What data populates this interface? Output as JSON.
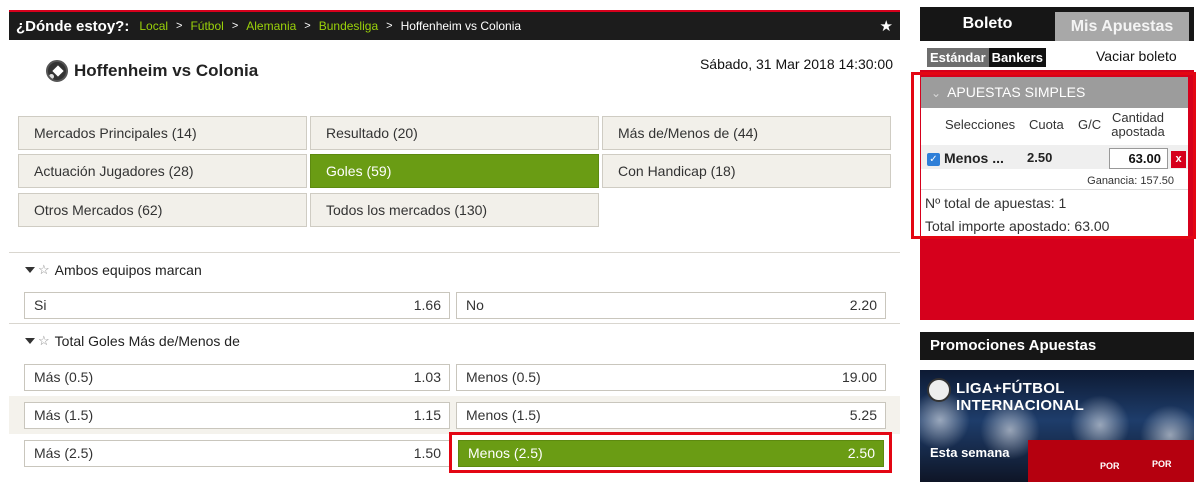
{
  "breadcrumb": {
    "title": "¿Dónde estoy?:",
    "links": [
      "Local",
      "Fútbol",
      "Alemania",
      "Bundesliga"
    ],
    "current": "Hoffenheim vs Colonia",
    "separator": ">"
  },
  "match": {
    "title": "Hoffenheim vs Colonia",
    "date": "Sábado, 31 Mar 2018 14:30:00",
    "icon": "football-icon"
  },
  "categories": [
    {
      "label": "Mercados Principales (14)"
    },
    {
      "label": "Resultado (20)"
    },
    {
      "label": "Más de/Menos de (44)"
    },
    {
      "label": "Actuación Jugadores (28)"
    },
    {
      "label": "Goles (59)",
      "active": true
    },
    {
      "label": "Con Handicap (18)"
    },
    {
      "label": "Otros Mercados (62)"
    },
    {
      "label": "Todos los mercados (130)"
    }
  ],
  "markets": [
    {
      "title": "Ambos equipos marcan",
      "rows": [
        [
          {
            "label": "Si",
            "odds": "1.66"
          },
          {
            "label": "No",
            "odds": "2.20"
          }
        ]
      ]
    },
    {
      "title": "Total Goles Más de/Menos de",
      "rows": [
        [
          {
            "label": "Más (0.5)",
            "odds": "1.03"
          },
          {
            "label": "Menos (0.5)",
            "odds": "19.00"
          }
        ],
        [
          {
            "label": "Más (1.5)",
            "odds": "1.15"
          },
          {
            "label": "Menos (1.5)",
            "odds": "5.25"
          }
        ],
        [
          {
            "label": "Más (2.5)",
            "odds": "1.50"
          },
          {
            "label": "Menos (2.5)",
            "odds": "2.50",
            "selected": true
          }
        ]
      ]
    }
  ],
  "betslip": {
    "tabs": [
      "Boleto",
      "Mis Apuestas"
    ],
    "modes": [
      "Estándar",
      "Bankers"
    ],
    "clear_label": "Vaciar boleto",
    "section_title": "APUESTAS SIMPLES",
    "columns": {
      "selection": "Selecciones",
      "odds": "Cuota",
      "gc": "G/C",
      "stake_line1": "Cantidad",
      "stake_line2": "apostada"
    },
    "bet": {
      "selection": "Menos ...",
      "odds": "2.50",
      "amount": "63.00",
      "remove": "x",
      "winnings": "Ganancia: 157.50"
    },
    "total_bets": "Nº total de apuestas: 1",
    "total_staked": "Total importe apostado: 63.00"
  },
  "promotions": {
    "title": "Promociones Apuestas",
    "banner_title": "LIGA+FÚTBOL INTERNACIONAL",
    "banner_subtitle": "Esta semana",
    "banner_tags": [
      "POR",
      "POR"
    ]
  },
  "colors": {
    "brand_red": "#d6001c",
    "selected_green": "#6a9c14",
    "link_green": "#9ad20a",
    "highlight_red": "#e30613"
  }
}
